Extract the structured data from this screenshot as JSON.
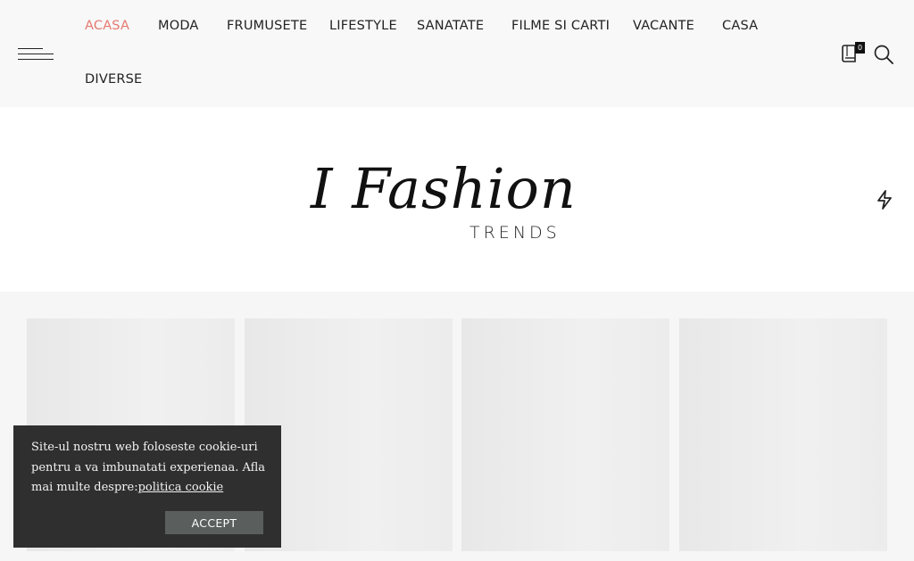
{
  "nav": {
    "items": [
      {
        "label": "ACASA",
        "active": true
      },
      {
        "label": "MODA"
      },
      {
        "label": "FRUMUSETE"
      },
      {
        "label": "LIFESTYLE"
      },
      {
        "label": "SANATATE"
      },
      {
        "label": "FILME SI CARTI"
      },
      {
        "label": "VACANTE"
      },
      {
        "label": "CASA"
      },
      {
        "label": "DIVERSE"
      }
    ]
  },
  "header_icons": {
    "cart_count": "0",
    "cart_icon": "cart-book-icon",
    "search_icon": "search-icon"
  },
  "logo": {
    "main": "I Fashion",
    "sub": "TRENDS"
  },
  "cookie": {
    "text": "Site-ul nostru web foloseste cookie-uri pentru a va imbunatati experienaa. Afla mai multe despre:",
    "link": "politica cookie",
    "accept": "ACCEPT"
  },
  "colors": {
    "active_nav": "#e57a6f",
    "cookie_bg": "#2f2f2f",
    "accept_bg": "#5a5f5e"
  }
}
